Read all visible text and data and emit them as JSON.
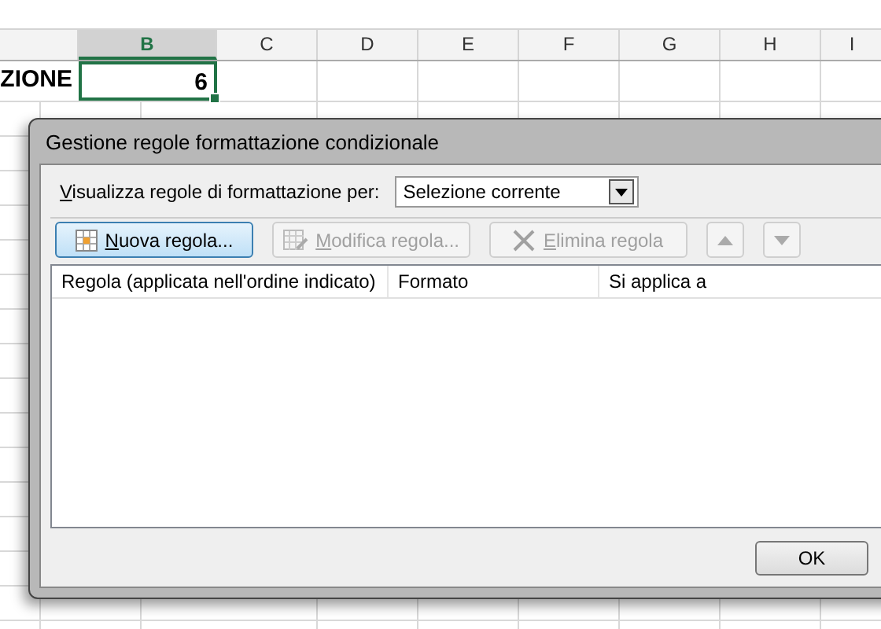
{
  "sheet": {
    "columns": [
      {
        "selected": false
      },
      {
        "label": "B",
        "selected": true
      },
      {
        "label": "C",
        "selected": false
      },
      {
        "label": "D",
        "selected": false
      },
      {
        "label": "E",
        "selected": false
      },
      {
        "label": "F",
        "selected": false
      },
      {
        "label": "G",
        "selected": false
      },
      {
        "label": "H",
        "selected": false
      },
      {
        "label": "I",
        "selected": false
      }
    ],
    "row": [
      {
        "value": "ZIONE",
        "selected": false
      },
      {
        "value": "6",
        "selected": true
      }
    ]
  },
  "dialog": {
    "title": "Gestione regole formattazione condizionale",
    "filter": {
      "label": "Visualizza regole di formattazione per:",
      "value": "Selezione corrente"
    },
    "toolbar": [
      {
        "kind": "text",
        "label": "Nuova regola...",
        "disabled": false,
        "focused": true
      },
      {
        "kind": "text",
        "label": "Modifica regola...",
        "disabled": true,
        "focused": false
      },
      {
        "kind": "text",
        "label": "Elimina regola",
        "disabled": true,
        "focused": false
      },
      {
        "kind": "arrow",
        "disabled": true,
        "focused": false
      },
      {
        "kind": "arrow",
        "disabled": true,
        "focused": false
      }
    ],
    "list_columns": [
      "Regola (applicata nell'ordine indicato)",
      "Formato",
      "Si applica a"
    ],
    "ok_button": "OK"
  }
}
